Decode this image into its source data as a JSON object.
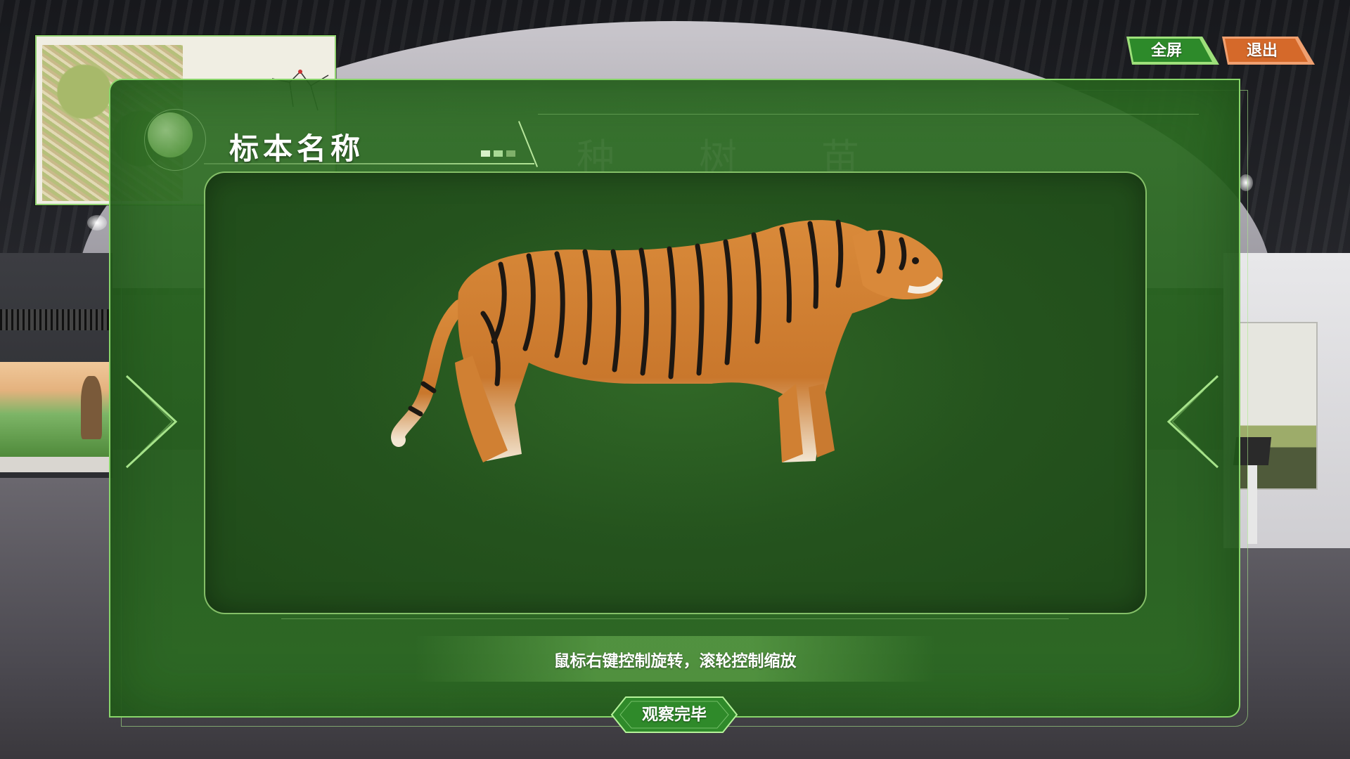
{
  "panel": {
    "title": "标本名称",
    "hint": "鼠标右键控制旋转，滚轮控制缩放",
    "done_button": "观察完毕"
  },
  "topbar": {
    "fullscreen": "全屏",
    "exit": "退出"
  },
  "specimen": {
    "icon": "tiger-model"
  },
  "colors": {
    "panel_green": "#2e6e24",
    "border_green": "#88d66a",
    "fullscreen_button": "#2c8a2c",
    "exit_button": "#d96a2a"
  }
}
